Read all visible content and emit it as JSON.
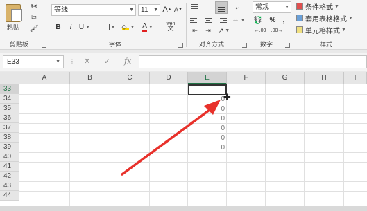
{
  "ribbon": {
    "clipboard": {
      "paste": "粘贴",
      "group": "剪贴板"
    },
    "font": {
      "name": "等线",
      "size": "11",
      "bold": "B",
      "italic": "I",
      "underline": "U",
      "font_color": "A",
      "grow": "A",
      "shrink": "A",
      "phonetic": "wén",
      "group": "字体"
    },
    "alignment": {
      "group": "对齐方式"
    },
    "number": {
      "format": "常规",
      "percent": "%",
      "comma": ",",
      "group": "数字"
    },
    "styles": {
      "conditional": "条件格式",
      "table": "套用表格格式",
      "cell": "单元格样式",
      "group": "样式"
    }
  },
  "formula_bar": {
    "name_box": "E33",
    "cancel": "✕",
    "enter": "✓",
    "fx": "fx"
  },
  "sheet": {
    "columns": [
      "A",
      "B",
      "C",
      "D",
      "E",
      "F",
      "G",
      "H",
      "I"
    ],
    "active_column": "E",
    "rows": [
      "33",
      "34",
      "35",
      "36",
      "37",
      "38",
      "39",
      "40",
      "41",
      "42",
      "43",
      "44"
    ],
    "active_row": "33",
    "e_values": [
      "0",
      "0",
      "0",
      "0",
      "0",
      "0"
    ]
  },
  "annotation": {
    "arrow_color": "#e8312b"
  },
  "colors": {
    "accent": "#217346"
  }
}
